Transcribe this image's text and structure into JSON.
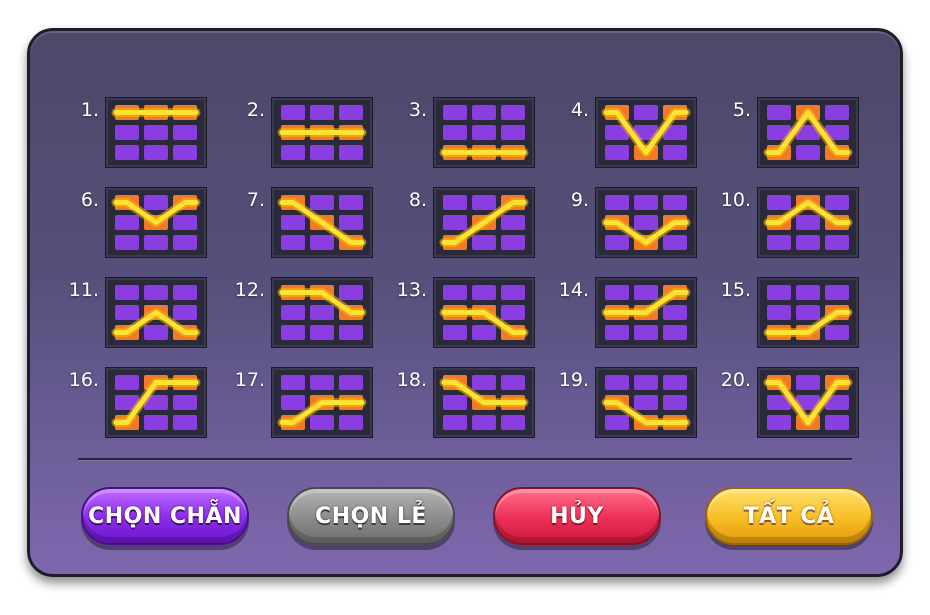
{
  "paylines": [
    {
      "label": "1.",
      "pattern": [
        0,
        0,
        0
      ]
    },
    {
      "label": "2.",
      "pattern": [
        1,
        1,
        1
      ]
    },
    {
      "label": "3.",
      "pattern": [
        2,
        2,
        2
      ]
    },
    {
      "label": "4.",
      "pattern": [
        0,
        2,
        0
      ]
    },
    {
      "label": "5.",
      "pattern": [
        2,
        0,
        2
      ]
    },
    {
      "label": "6.",
      "pattern": [
        0,
        1,
        0
      ]
    },
    {
      "label": "7.",
      "pattern": [
        0,
        1,
        2
      ]
    },
    {
      "label": "8.",
      "pattern": [
        2,
        1,
        0
      ]
    },
    {
      "label": "9.",
      "pattern": [
        1,
        2,
        1
      ]
    },
    {
      "label": "10.",
      "pattern": [
        1,
        0,
        1
      ]
    },
    {
      "label": "11.",
      "pattern": [
        2,
        1,
        2
      ]
    },
    {
      "label": "12.",
      "pattern": [
        0,
        0,
        1
      ]
    },
    {
      "label": "13.",
      "pattern": [
        1,
        1,
        2
      ]
    },
    {
      "label": "14.",
      "pattern": [
        1,
        1,
        0
      ]
    },
    {
      "label": "15.",
      "pattern": [
        2,
        2,
        1
      ]
    },
    {
      "label": "16.",
      "pattern": [
        2,
        0,
        0
      ]
    },
    {
      "label": "17.",
      "pattern": [
        2,
        1,
        1
      ]
    },
    {
      "label": "18.",
      "pattern": [
        0,
        1,
        1
      ]
    },
    {
      "label": "19.",
      "pattern": [
        1,
        2,
        2
      ]
    },
    {
      "label": "20.",
      "pattern": [
        0,
        2,
        0
      ]
    }
  ],
  "buttons": {
    "even": "CHỌN CHẴN",
    "odd": "CHỌN LẺ",
    "cancel": "HỦY",
    "all": "TẤT CẢ"
  },
  "colors": {
    "cell": "#8a3de0",
    "cell_active": "#f07a2a",
    "line": "#ffe233",
    "line_glow": "#ffb800"
  }
}
